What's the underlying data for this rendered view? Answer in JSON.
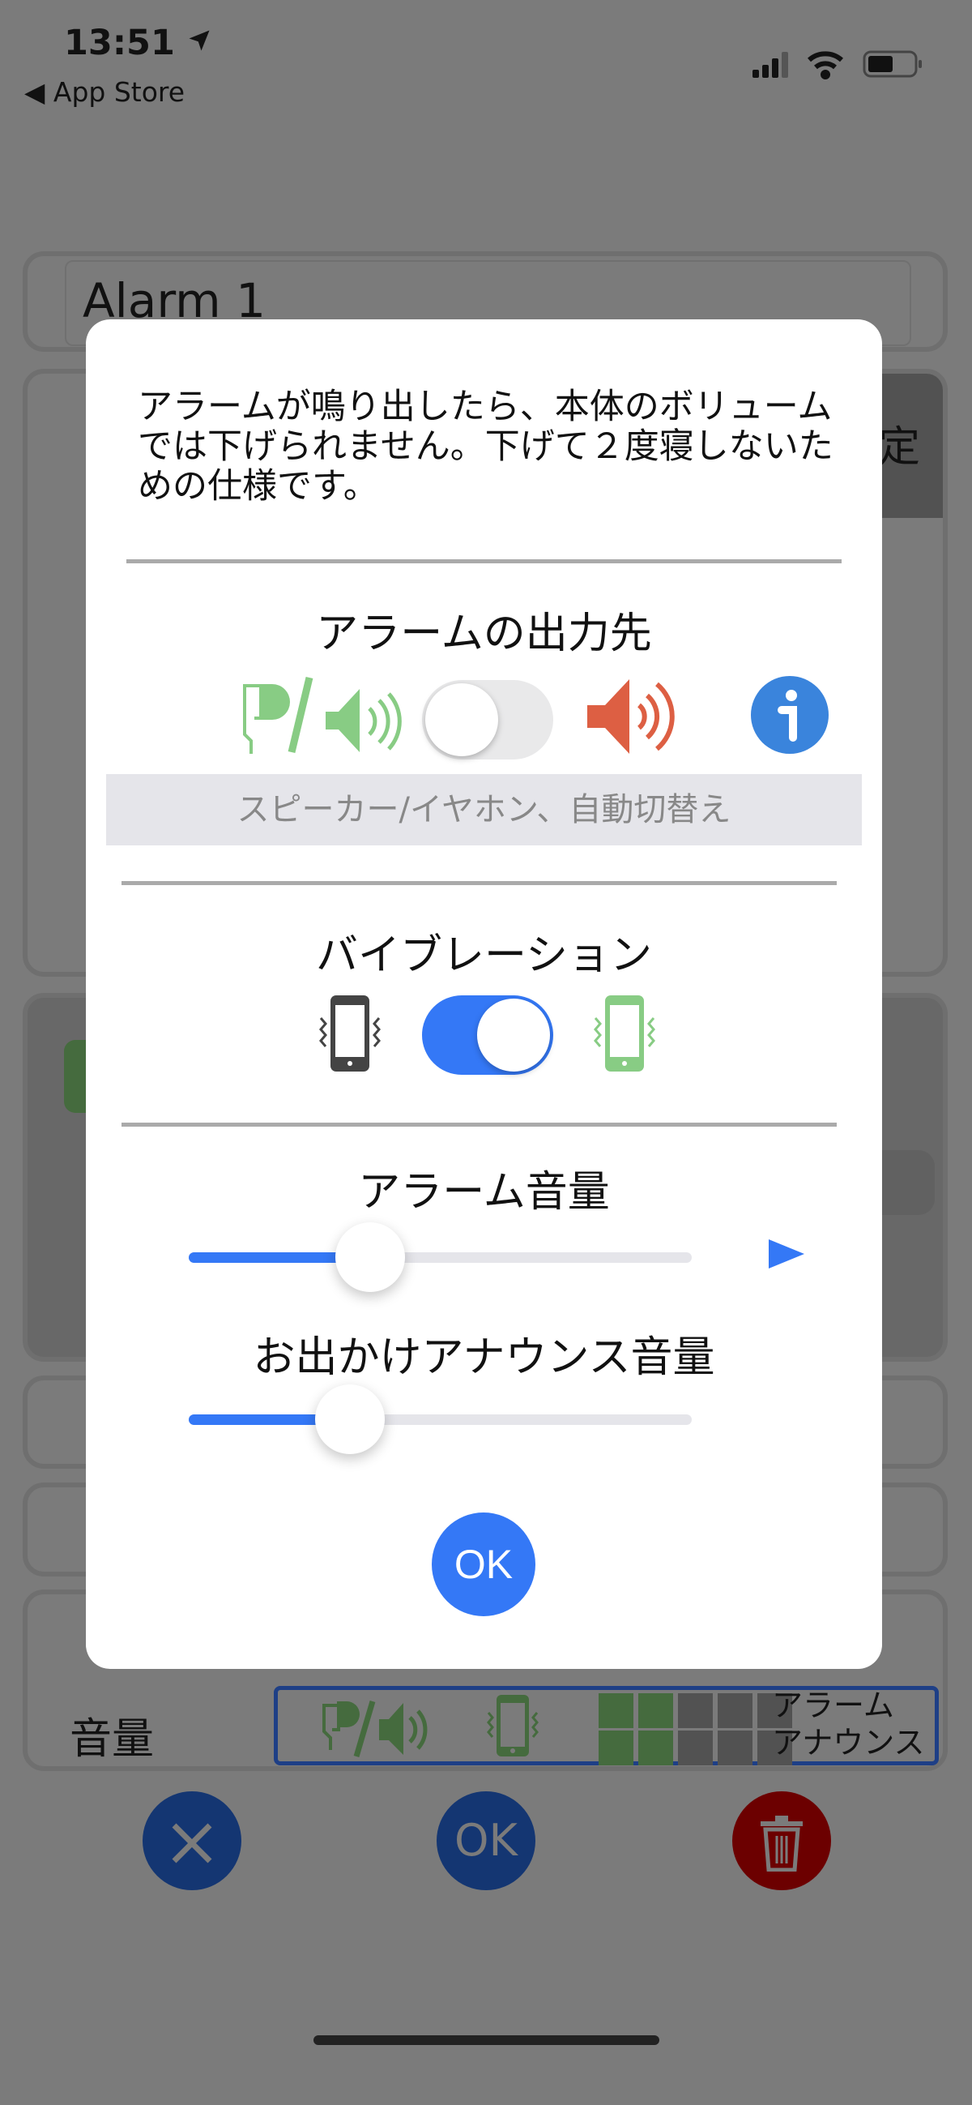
{
  "status_bar": {
    "time": "13:51",
    "back_label": "App Store",
    "icons": [
      "location-arrow-icon",
      "signal-icon",
      "wifi-icon",
      "battery-icon"
    ]
  },
  "background": {
    "alarm_name": "Alarm 1",
    "partial_header_char": "定",
    "volume_label": "音量",
    "volume_summary": {
      "alarm_label": "アラーム",
      "announce_label": "アナウンス",
      "alarm_level": 2,
      "announce_level": 2,
      "max_level": 5
    },
    "buttons": {
      "cancel_icon": "x-icon",
      "ok_label": "OK",
      "delete_icon": "trash-icon"
    }
  },
  "modal": {
    "message": "アラームが鳴り出したら、本体のボリュームでは下げられません。下げて２度寝しないための仕様です。",
    "output": {
      "title": "アラームの出力先",
      "toggle_on": false,
      "hint": "スピーカー/イヤホン、自動切替え",
      "left_icon": "earphone-speaker-icon",
      "right_icon": "speaker-icon",
      "info_icon": "info-icon"
    },
    "vibration": {
      "title": "バイブレーション",
      "toggle_on": true
    },
    "alarm_volume": {
      "title": "アラーム音量",
      "value": 0.36
    },
    "announce_volume": {
      "title": "お出かけアナウンス音量",
      "value": 0.32
    },
    "ok_label": "OK"
  },
  "colors": {
    "accent": "#3478f6",
    "green": "#88cc84",
    "red": "#dd5f43",
    "info": "#3a84dc"
  }
}
